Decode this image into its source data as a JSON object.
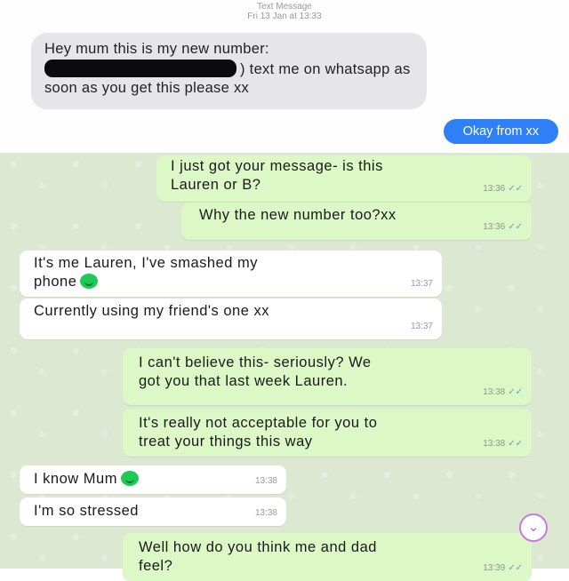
{
  "sms": {
    "header_title": "Text Message",
    "header_time": "Fri 13 Jan at 13:33",
    "incoming_text_before": "Hey mum this is my new number:",
    "incoming_text_after": ") text me on whatsapp as soon as you get this please xx",
    "reply_text": "Okay from xx"
  },
  "whatsapp": {
    "messages": [
      {
        "dir": "out",
        "text": "I just got your message- is this\nLauren or B?",
        "time": "13:36",
        "ticks": "✓✓"
      },
      {
        "dir": "out",
        "text": "Why the new number too?xx",
        "time": "13:36",
        "ticks": "✓✓"
      },
      {
        "dir": "in",
        "text": "It's me Lauren, I've smashed my\nphone",
        "time": "13:37",
        "emoji": "smiling-face-emoji"
      },
      {
        "dir": "in",
        "text": "Currently using my friend's one xx",
        "time": "13:37"
      },
      {
        "dir": "out",
        "text": "I can't believe this- seriously? We\ngot you that last week Lauren.",
        "time": "13:38",
        "ticks": "✓✓"
      },
      {
        "dir": "out",
        "text": "It's really not acceptable for you to\ntreat your things this way",
        "time": "13:38",
        "ticks": "✓✓"
      },
      {
        "dir": "in",
        "text": "I know Mum",
        "time": "13:38",
        "emoji": "smiling-face-emoji"
      },
      {
        "dir": "in",
        "text": "I'm so stressed",
        "time": "13:38"
      },
      {
        "dir": "out",
        "text": "Well how do you think me and dad\nfeel?",
        "time": "13:39",
        "ticks": "✓✓"
      }
    ],
    "scroll_down_icon": "chevron-down-icon"
  },
  "colors": {
    "sms_bubble": "#e6e6e8",
    "sms_reply": "#2f7ff6",
    "wa_background": "#dde8d2",
    "wa_outgoing": "#dcf8c6",
    "wa_incoming": "#ffffff",
    "read_ticks": "#4fa9e8"
  }
}
